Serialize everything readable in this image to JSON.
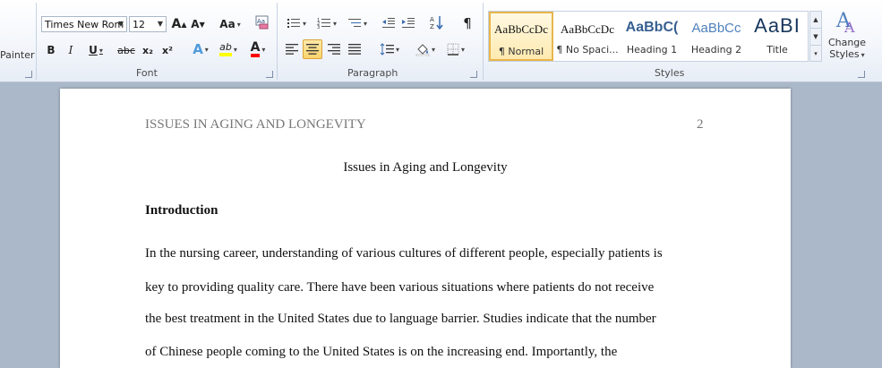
{
  "clipboard": {
    "painter_label": "Painter"
  },
  "font": {
    "name": "Times New Rom",
    "size": "12",
    "group_label": "Font",
    "grow": "A",
    "shrink": "A",
    "case": "Aa",
    "bold": "B",
    "italic": "I",
    "underline": "U",
    "strike": "abc",
    "subscript": "x₂",
    "superscript": "x²",
    "effects": "A",
    "highlight": "ab",
    "color": "A"
  },
  "paragraph": {
    "group_label": "Paragraph",
    "show_marks": "¶"
  },
  "styles": {
    "group_label": "Styles",
    "tiles": [
      {
        "preview": "AaBbCcDc",
        "name": "¶ Normal"
      },
      {
        "preview": "AaBbCcDc",
        "name": "¶ No Spaci..."
      },
      {
        "preview": "AaBbC(",
        "name": "Heading 1"
      },
      {
        "preview": "AaBbCc",
        "name": "Heading 2"
      },
      {
        "preview": "AaBI",
        "name": "Title"
      }
    ],
    "change_styles": {
      "line1": "Change",
      "line2": "Styles"
    }
  },
  "colors": {
    "accent_blue": "#365f91",
    "heading2_blue": "#4f81bd",
    "highlight_yellow": "#ffff00",
    "font_red": "#ff0000"
  },
  "document": {
    "running_head": "ISSUES IN AGING AND LONGEVITY",
    "page_number": "2",
    "title": "Issues in Aging and Longevity",
    "heading": "Introduction",
    "lines": [
      "In the nursing career, understanding of various cultures of different people, especially patients is",
      "key to providing quality care. There have been various situations where patients do not receive",
      "the best treatment in the United States due to language barrier.  Studies indicate that the number",
      "of Chinese people coming to the United States is on the increasing end. Importantly, the"
    ]
  }
}
